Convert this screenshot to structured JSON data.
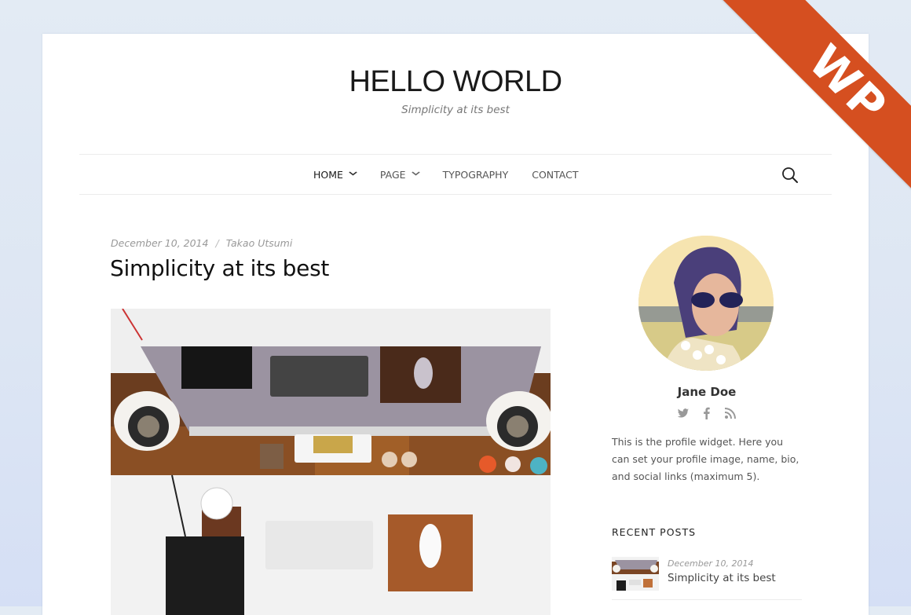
{
  "site": {
    "title": "HELLO WORLD",
    "tagline": "Simplicity at its best"
  },
  "nav": {
    "items": [
      {
        "label": "HOME",
        "has_dropdown": true,
        "active": true
      },
      {
        "label": "PAGE",
        "has_dropdown": true,
        "active": false
      },
      {
        "label": "TYPOGRAPHY",
        "has_dropdown": false,
        "active": false
      },
      {
        "label": "CONTACT",
        "has_dropdown": false,
        "active": false
      }
    ],
    "search_icon": "search-icon",
    "chevron": "⌄"
  },
  "post": {
    "date": "December 10, 2014",
    "separator": "/",
    "author": "Takao Utsumi",
    "title": "Simplicity at its best",
    "image_alt": "Desk workspace viewed from above"
  },
  "sidebar": {
    "profile": {
      "name": "Jane Doe",
      "bio": "This is the profile widget. Here you can set your profile image, name, bio, and social links (maximum 5).",
      "socials": [
        "twitter-icon",
        "facebook-icon",
        "rss-icon"
      ]
    },
    "recent_posts": {
      "heading": "RECENT POSTS",
      "items": [
        {
          "date": "December 10, 2014",
          "title": "Simplicity at its best"
        }
      ]
    }
  },
  "ribbon": {
    "label": "WP",
    "color": "#d54f20"
  }
}
